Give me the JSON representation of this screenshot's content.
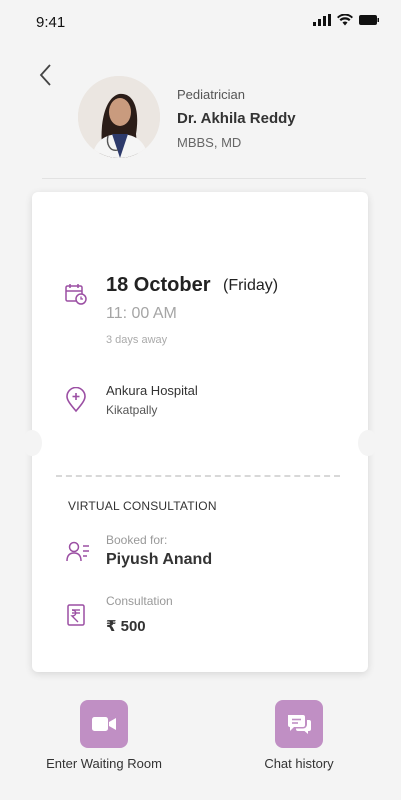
{
  "status_bar": {
    "time": "9:41"
  },
  "doctor": {
    "specialty": "Pediatrician",
    "name": "Dr. Akhila Reddy",
    "qualifications": "MBBS, MD"
  },
  "appointment": {
    "date": "18 October",
    "day": "(Friday)",
    "time": "11: 00 AM",
    "relative": "3 days away"
  },
  "location": {
    "hospital": "Ankura Hospital",
    "area": "Kikatpally"
  },
  "consultation_type": "VIRTUAL CONSULTATION",
  "booking": {
    "label": "Booked for:",
    "patient": "Piyush Anand"
  },
  "fee": {
    "label": "Consultation",
    "amount": "₹ 500"
  },
  "actions": {
    "waiting_room": "Enter Waiting Room",
    "chat_history": "Chat history"
  },
  "colors": {
    "accent": "#9b4fa3",
    "button_bg": "#c08fc4"
  }
}
